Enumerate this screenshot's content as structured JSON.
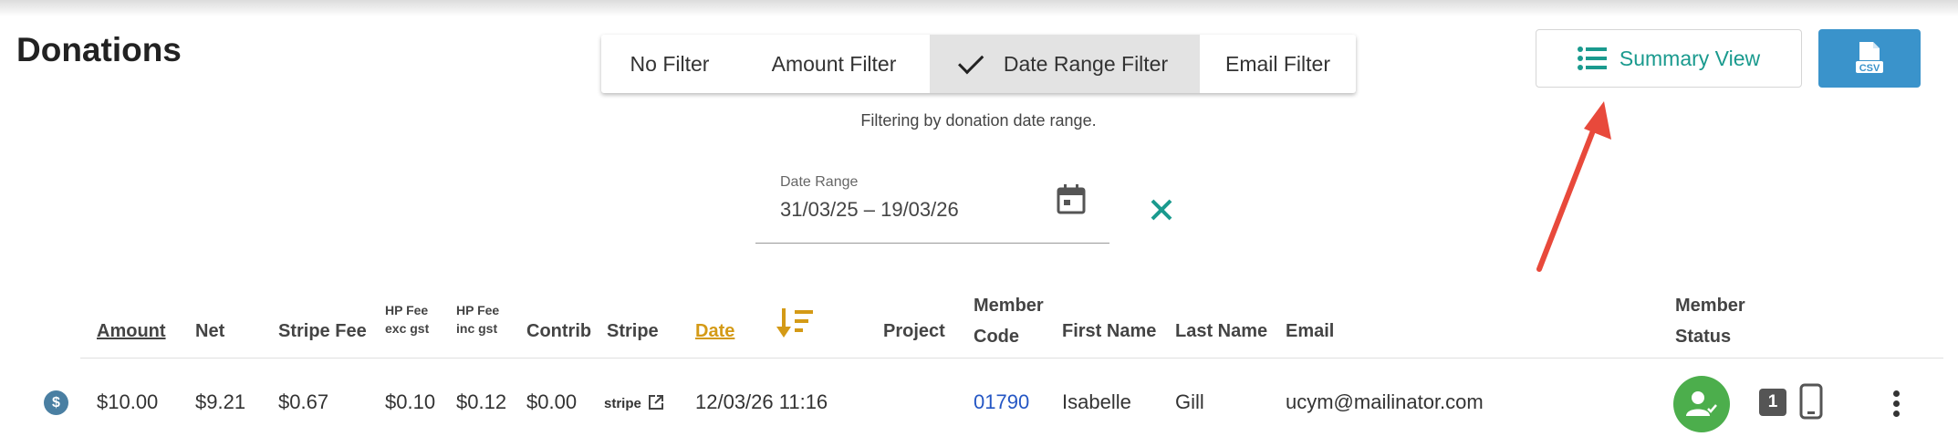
{
  "page": {
    "title": "Donations"
  },
  "filters": {
    "options": [
      "No Filter",
      "Amount Filter",
      "Date Range Filter",
      "Email Filter"
    ],
    "active": "Date Range Filter",
    "note": "Filtering by donation date range."
  },
  "date_range": {
    "label": "Date Range",
    "value": "31/03/25 – 19/03/26"
  },
  "actions": {
    "summary_label": "Summary View",
    "csv_icon": "csv-file-icon"
  },
  "table": {
    "headers": {
      "amount": "Amount",
      "net": "Net",
      "stripe_fee": "Stripe Fee",
      "hp_fee_exc_1": "HP Fee",
      "hp_fee_exc_2": "exc gst",
      "hp_fee_inc_1": "HP Fee",
      "hp_fee_inc_2": "inc gst",
      "contrib": "Contrib",
      "stripe": "Stripe",
      "date": "Date",
      "project": "Project",
      "member_code_1": "Member",
      "member_code_2": "Code",
      "first_name": "First Name",
      "last_name": "Last Name",
      "email": "Email",
      "member_status_1": "Member",
      "member_status_2": "Status"
    },
    "rows": [
      {
        "coin": "$",
        "amount": "$10.00",
        "net": "$9.21",
        "stripe_fee": "$0.67",
        "hp_fee_exc": "$0.10",
        "hp_fee_inc": "$0.12",
        "contrib": "$0.00",
        "stripe": "stripe",
        "date": "12/03/26 11:16",
        "project": "",
        "member_code": "01790",
        "first_name": "Isabelle",
        "last_name": "Gill",
        "email": "ucym@mailinator.com",
        "badge_count": "1"
      }
    ]
  },
  "colors": {
    "accent": "#1a9a8e",
    "csv_button": "#3a93cb",
    "date_header": "#d49a16",
    "status_green": "#4cae4c",
    "annotation_arrow": "#e8493b"
  }
}
